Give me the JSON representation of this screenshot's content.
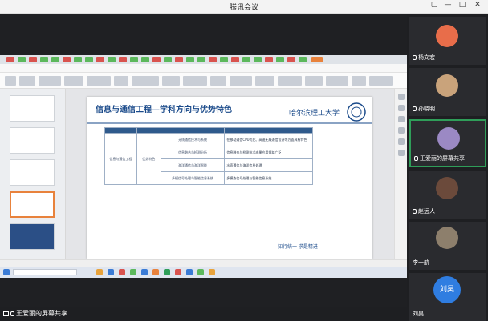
{
  "window": {
    "title": "腾讯会议",
    "controls": [
      "▢",
      "—",
      "□",
      "✕"
    ]
  },
  "slide": {
    "title": "信息与通信工程—学科方向与优势特色",
    "motto": "知行统一   求是精进",
    "table_rows": [
      {
        "left": "信息与通信工程",
        "left2": "优势特色",
        "mid": "无线通信技术与系统",
        "right": "在移动通信CPU优化、高速无线通信设计等方面具有特色"
      },
      {
        "left": "",
        "left2": "",
        "mid": "信息融合与检测分析",
        "right": "信息融合与检测技术成果应用领域广泛"
      },
      {
        "left": "",
        "left2": "",
        "mid": "海洋通信与海洋智能",
        "right": "水声通信与海洋信息处理"
      },
      {
        "left": "",
        "left2": "",
        "mid": "多模信号处理与智能信息系统",
        "right": "多模态信号处理与智能信息系统"
      }
    ]
  },
  "sidebar": {
    "participants": [
      {
        "name": "杨文宏",
        "avatar_color": "#e86d4a",
        "mic": true
      },
      {
        "name": "孙晓明",
        "avatar_color": "#c9a37b",
        "mic": true
      },
      {
        "name": "王爱丽的屏幕共享",
        "avatar_color": "#9b89c4",
        "mic": true,
        "active": true
      },
      {
        "name": "赵远人",
        "avatar_color": "#6b4a3b",
        "mic": true
      },
      {
        "name": "李一航",
        "avatar_color": "#8d7f6c",
        "mic": false
      },
      {
        "name": "刘昊",
        "avatar_color": "#2f7de1",
        "mic": false,
        "initials": "刘昊"
      }
    ]
  },
  "share": {
    "label": "王爱丽的屏幕共享"
  },
  "colors": {
    "accent": "#2f9e59",
    "slide_title": "#1a4a8a"
  }
}
